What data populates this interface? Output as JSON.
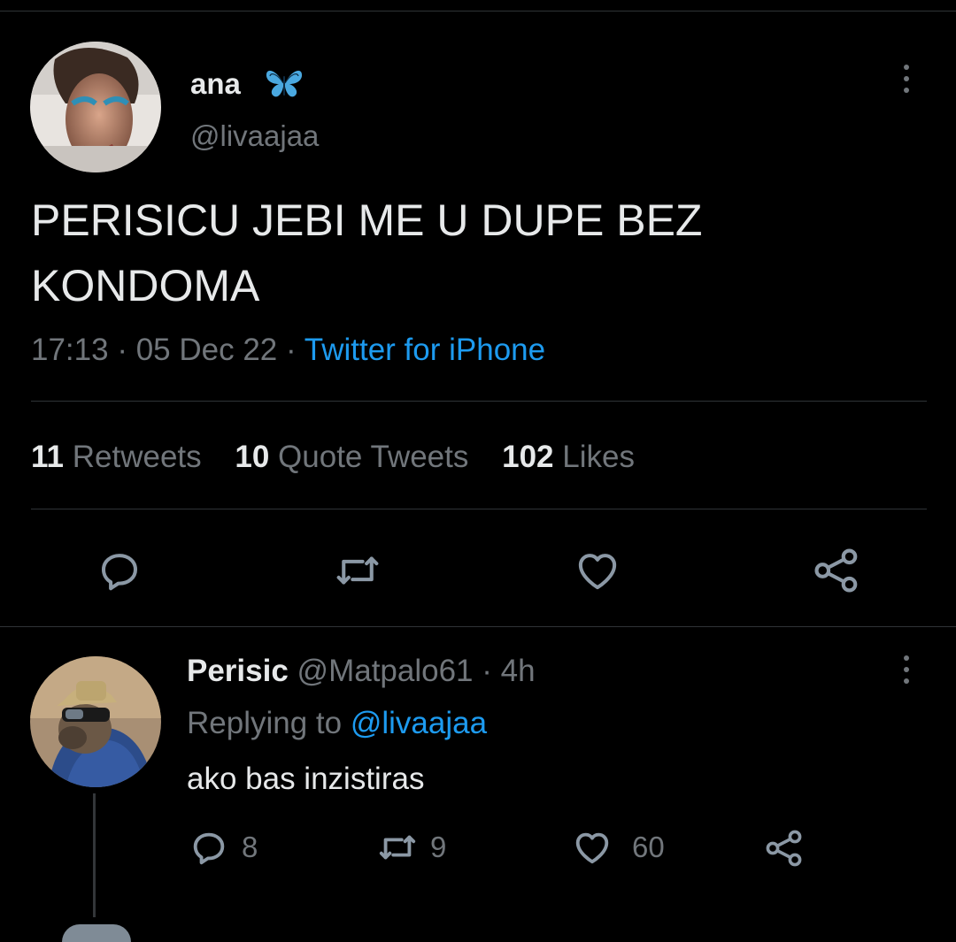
{
  "tweet": {
    "author_name": "ana",
    "author_handle": "@livaajaa",
    "text_line1": "PERISICU JEBI ME U DUPE BEZ",
    "text_line2": "KONDOMA",
    "time": "17:13",
    "sep1": "·",
    "date": "05 Dec 22",
    "sep2": "·",
    "source": "Twitter for iPhone",
    "stats": {
      "retweets_count": "11",
      "retweets_label": "Retweets",
      "quotes_count": "10",
      "quotes_label": "Quote Tweets",
      "likes_count": "102",
      "likes_label": "Likes"
    }
  },
  "reply": {
    "author_name": "Perisic",
    "author_handle": "@Matpalo61",
    "sep": "·",
    "age": "4h",
    "replying_prefix": "Replying to",
    "replying_handle": "@livaajaa",
    "text": "ako bas inzistiras",
    "replies_count": "8",
    "retweets_count": "9",
    "likes_count": "60"
  },
  "icons": {
    "verified_badge": "butterfly-icon",
    "reply": "comment-bubble-icon",
    "retweet": "retweet-icon",
    "like": "heart-icon",
    "share": "share-icon",
    "more": "more-dots-icon"
  },
  "colors": {
    "background": "#000000",
    "text": "#e7e9ea",
    "secondary": "#71767b",
    "accent": "#1d9bf0",
    "divider": "#2f3336"
  }
}
